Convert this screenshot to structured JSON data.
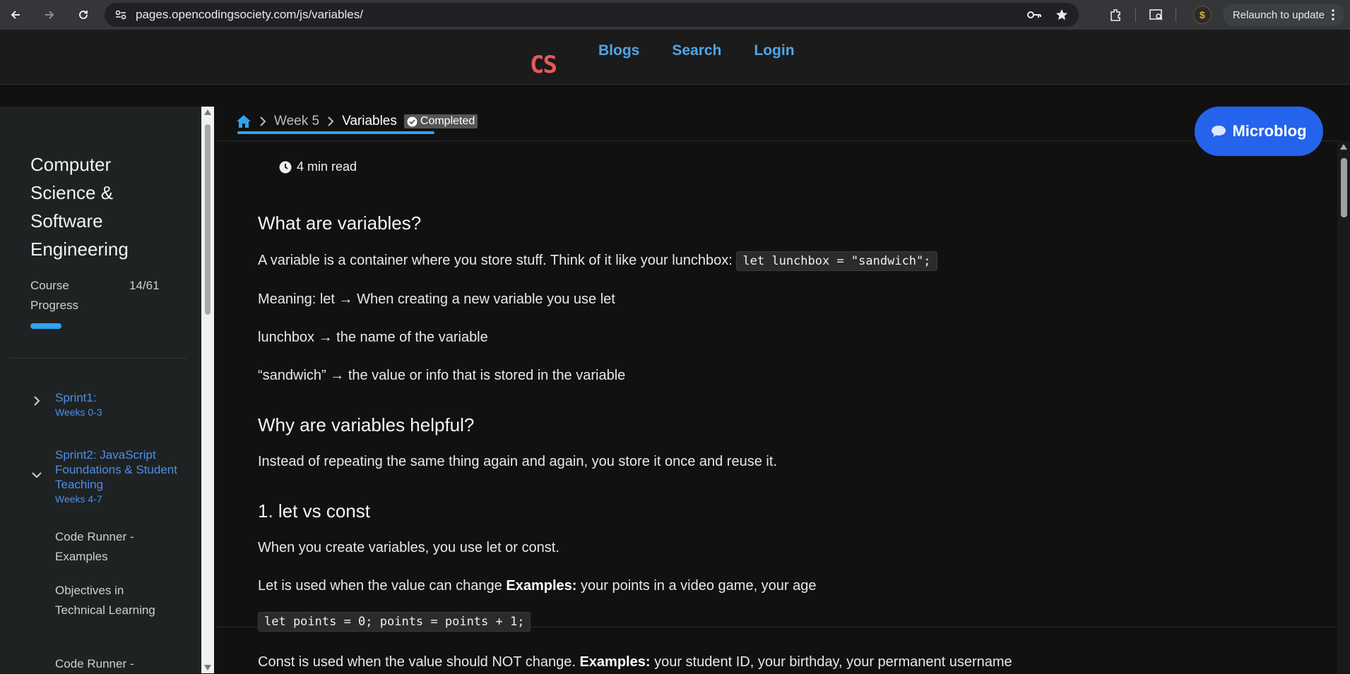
{
  "browser": {
    "url": "pages.opencodingsociety.com/js/variables/",
    "relaunch_label": "Relaunch to update",
    "avatar_glyph": "$"
  },
  "site": {
    "logo": "CS",
    "nav": [
      "Blogs",
      "Search",
      "Login"
    ]
  },
  "sidebar": {
    "title": "Computer Science & Software Engineering",
    "progress_label": "Course Progress",
    "progress_count": "14/61",
    "progress_fraction": 0.23,
    "sprints": [
      {
        "title": "Sprint1:",
        "weeks": "Weeks 0-3",
        "expanded": false
      },
      {
        "title": "Sprint2: JavaScript Foundations & Student Teaching",
        "weeks": "Weeks 4-7",
        "expanded": true
      }
    ],
    "lessons": [
      "Code Runner - Examples",
      "Objectives in Technical Learning",
      "Code Runner -"
    ]
  },
  "breadcrumb": {
    "week": "Week 5",
    "current": "Variables",
    "badge": "Completed"
  },
  "microblog_label": "Microblog",
  "article": {
    "read_time": "4 min read",
    "h_what": "What are variables?",
    "p1_text": "A variable is a container where you store stuff. Think of it like your lunchbox:",
    "p1_code": "let lunchbox = \"sandwich\";",
    "p2": "Meaning: let → When creating a new variable you use let",
    "p3": "lunchbox → the name of the variable",
    "p4": "“sandwich” → the value or info that is stored in the variable",
    "h_why": "Why are variables helpful?",
    "p5": "Instead of repeating the same thing again and again, you store it once and reuse it.",
    "h_let": "1. let vs const",
    "p6": "When you create variables, you use let or const.",
    "p7_pre": "Let is used when the value can change ",
    "p7_bold": "Examples:",
    "p7_post": " your points in a video game, your age",
    "code_let": "let points = 0; points = points + 1;",
    "p8_pre": "Const is used when the value should NOT change. ",
    "p8_bold": "Examples:",
    "p8_post": " your student ID, your birthday, your permanent username"
  },
  "colors": {
    "accent": "#2ea3f2",
    "microblog": "#2463eb",
    "nav_link": "#4fa6e6",
    "logo": "#e45a5a"
  }
}
